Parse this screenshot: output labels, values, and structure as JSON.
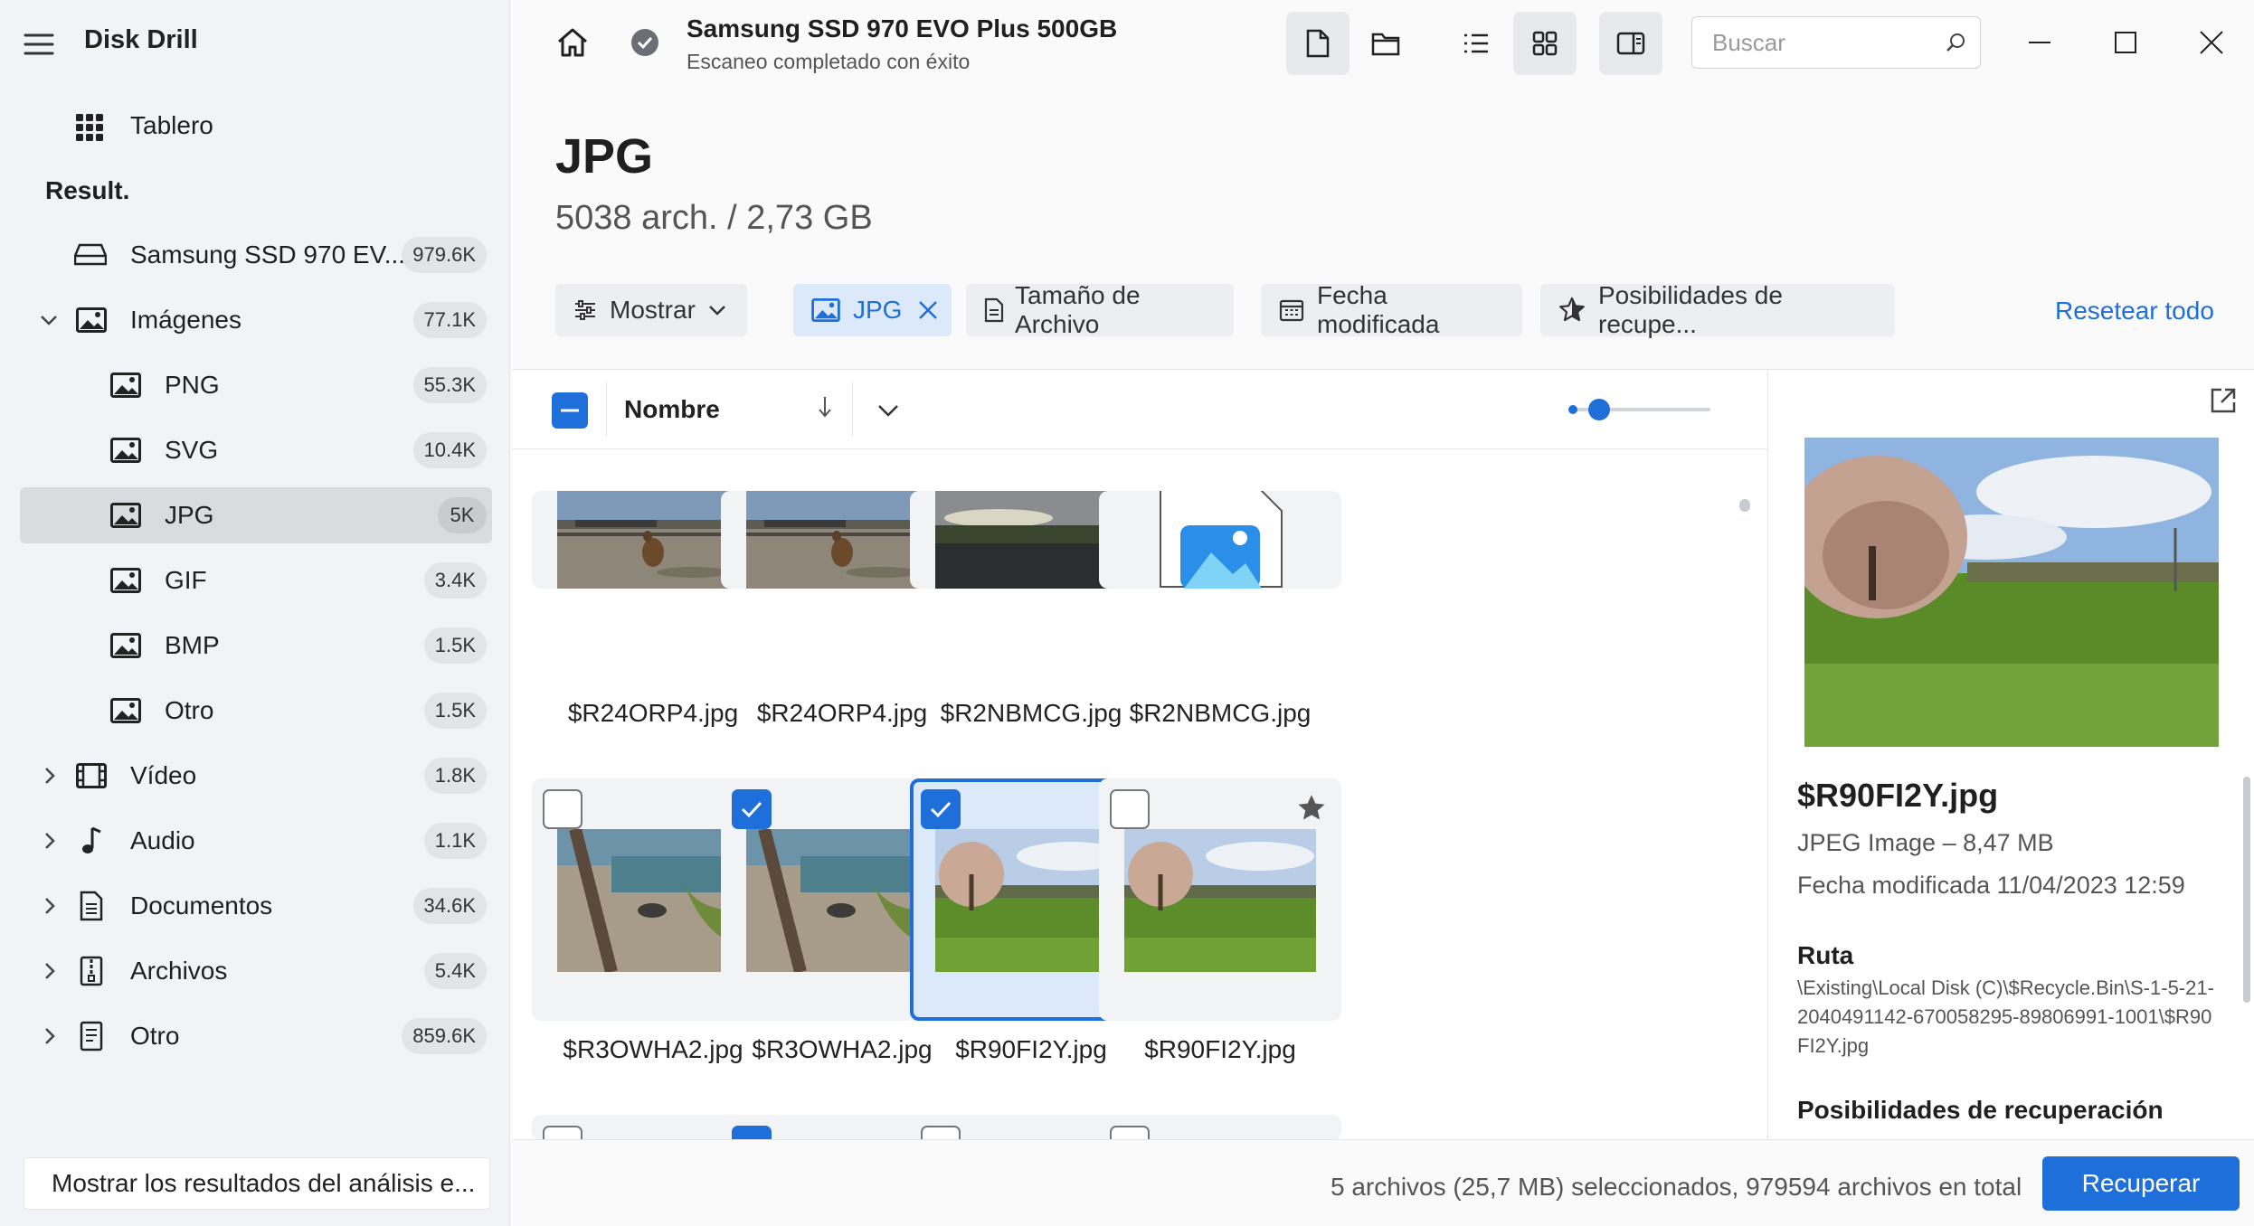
{
  "app": {
    "title": "Disk Drill"
  },
  "sidebar": {
    "dashboard_label": "Tablero",
    "results_heading": "Result.",
    "items": [
      {
        "label": "Samsung SSD 970 EV...",
        "count": "979.6K",
        "icon": "drive-icon"
      },
      {
        "label": "Imágenes",
        "count": "77.1K",
        "icon": "image-icon",
        "expanded": true
      },
      {
        "label": "PNG",
        "count": "55.3K",
        "icon": "image-icon"
      },
      {
        "label": "SVG",
        "count": "10.4K",
        "icon": "image-icon"
      },
      {
        "label": "JPG",
        "count": "5K",
        "icon": "image-icon",
        "active": true
      },
      {
        "label": "GIF",
        "count": "3.4K",
        "icon": "image-icon"
      },
      {
        "label": "BMP",
        "count": "1.5K",
        "icon": "image-icon"
      },
      {
        "label": "Otro",
        "count": "1.5K",
        "icon": "image-icon"
      },
      {
        "label": "Vídeo",
        "count": "1.8K",
        "icon": "film-icon"
      },
      {
        "label": "Audio",
        "count": "1.1K",
        "icon": "music-note-icon"
      },
      {
        "label": "Documentos",
        "count": "34.6K",
        "icon": "document-icon"
      },
      {
        "label": "Archivos",
        "count": "5.4K",
        "icon": "archive-icon"
      },
      {
        "label": "Otro",
        "count": "859.6K",
        "icon": "file-icon"
      }
    ],
    "show_results_button": "Mostrar los resultados del análisis e..."
  },
  "topbar": {
    "device_title": "Samsung SSD 970 EVO Plus 500GB",
    "device_status": "Escaneo completado con éxito",
    "search_placeholder": "Buscar"
  },
  "header": {
    "title": "JPG",
    "subtitle": "5038 arch. / 2,73 GB"
  },
  "filters": {
    "show": "Mostrar",
    "type_chip": "JPG",
    "size": "Tamaño de Archivo",
    "date": "Fecha modificada",
    "recovery": "Posibilidades de recupe...",
    "reset": "Resetear todo"
  },
  "grid": {
    "sort_column": "Nombre",
    "files": [
      {
        "name": "$R24ORP4.jpg",
        "checked": false
      },
      {
        "name": "$R24ORP4.jpg",
        "checked": true
      },
      {
        "name": "$R2NBMCG.jpg",
        "checked": false
      },
      {
        "name": "$R2NBMCG.jpg",
        "checked": false
      },
      {
        "name": "$R3OWHA2.jpg",
        "checked": false
      },
      {
        "name": "$R3OWHA2.jpg",
        "checked": true
      },
      {
        "name": "$R90FI2Y.jpg",
        "checked": true,
        "selected": true
      },
      {
        "name": "$R90FI2Y.jpg",
        "checked": false
      }
    ]
  },
  "preview": {
    "file_name": "$R90FI2Y.jpg",
    "file_type": "JPEG Image – 8,47 MB",
    "modified": "Fecha modificada 11/04/2023 12:59",
    "path_heading": "Ruta",
    "path": "\\Existing\\Local Disk (C)\\$Recycle.Bin\\S-1-5-21-2040491142-670058295-89806991-1001\\$R90FI2Y.jpg",
    "recovery_heading": "Posibilidades de recuperación"
  },
  "status": {
    "summary": "5 archivos (25,7 MB) seleccionados, 979594 archivos en total",
    "recover_button": "Recuperar"
  },
  "colors": {
    "accent": "#1e6fd9"
  }
}
